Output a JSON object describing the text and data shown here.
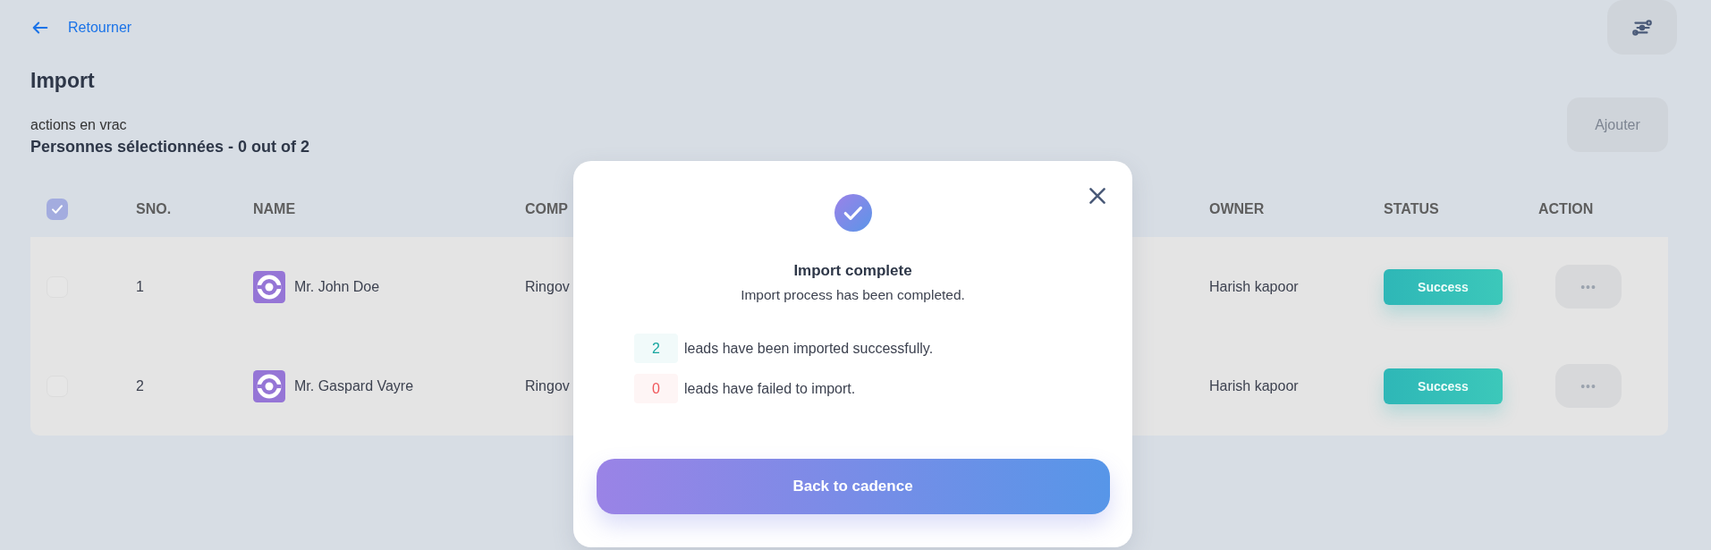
{
  "back_link": {
    "label": "Retourner"
  },
  "page_title": "Import",
  "bulk_label": "actions en vrac",
  "selection_summary": "Personnes sélectionnées - 0 out of 2",
  "add_button": {
    "label": "Ajouter",
    "disabled": true
  },
  "table": {
    "header_checkbox": {
      "checked": true
    },
    "columns": [
      "SNO.",
      "NAME",
      "COMP",
      "OWNER",
      "STATUS",
      "ACTION"
    ],
    "rows": [
      {
        "checked": false,
        "sno": "1",
        "name": "Mr. John Doe",
        "company": "Ringov",
        "owner": "Harish kapoor",
        "status": "Success",
        "action": "•••"
      },
      {
        "checked": false,
        "sno": "2",
        "name": "Mr. Gaspard Vayre",
        "company": "Ringov",
        "owner": "Harish kapoor",
        "status": "Success",
        "action": "•••"
      }
    ]
  },
  "modal": {
    "title": "Import complete",
    "subtitle": "Import process has been completed.",
    "stats": [
      {
        "kind": "success",
        "count": "2",
        "text": "leads have been imported successfully."
      },
      {
        "kind": "failure",
        "count": "0",
        "text": "leads have failed to import."
      }
    ],
    "button": "Back to cadence"
  }
}
